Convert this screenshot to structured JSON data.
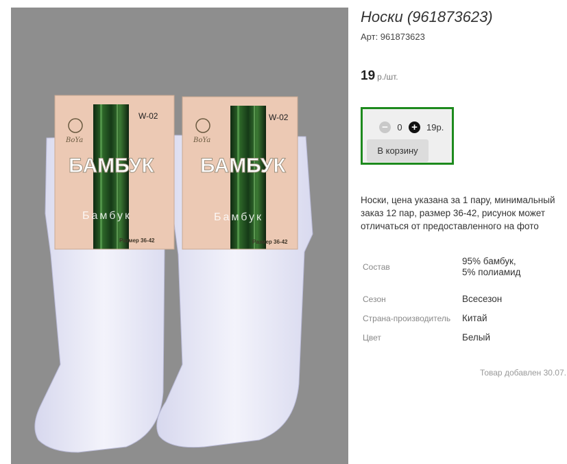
{
  "product": {
    "title": "Носки (961873623)",
    "article": "Арт: 961873623",
    "price_value": "19",
    "price_unit": "р./шт.",
    "image": {
      "packages": [
        {
          "code": "W-02",
          "brand": "BoYa",
          "name_big": "БАМБУК",
          "name_small": "Бамбук",
          "size_label": "Размер 36-42"
        },
        {
          "code": "W-02",
          "brand": "BoYa",
          "name_big": "БАМБУК",
          "name_small": "Бамбук",
          "size_label": "Размер 36-42"
        }
      ]
    }
  },
  "buy_box": {
    "minus_icon": "minus-circle-icon",
    "plus_icon": "plus-circle-icon",
    "quantity": "0",
    "sum": "19р.",
    "cart_label": "В корзину",
    "accent_color": "#1d8a1d"
  },
  "description": "Носки, цена указана за 1 пару, минимальный заказ 12 пар, размер 36-42, рисунок может отличаться от предоставленного на фото",
  "properties": [
    {
      "label": "Состав",
      "value": "95% бамбук, 5% полиамид"
    },
    {
      "label": "Сезон",
      "value": "Всесезон"
    },
    {
      "label": "Страна-производитель",
      "value": "Китай"
    },
    {
      "label": "Цвет",
      "value": "Белый"
    }
  ],
  "added_note": "Товар добавлен 30.07."
}
